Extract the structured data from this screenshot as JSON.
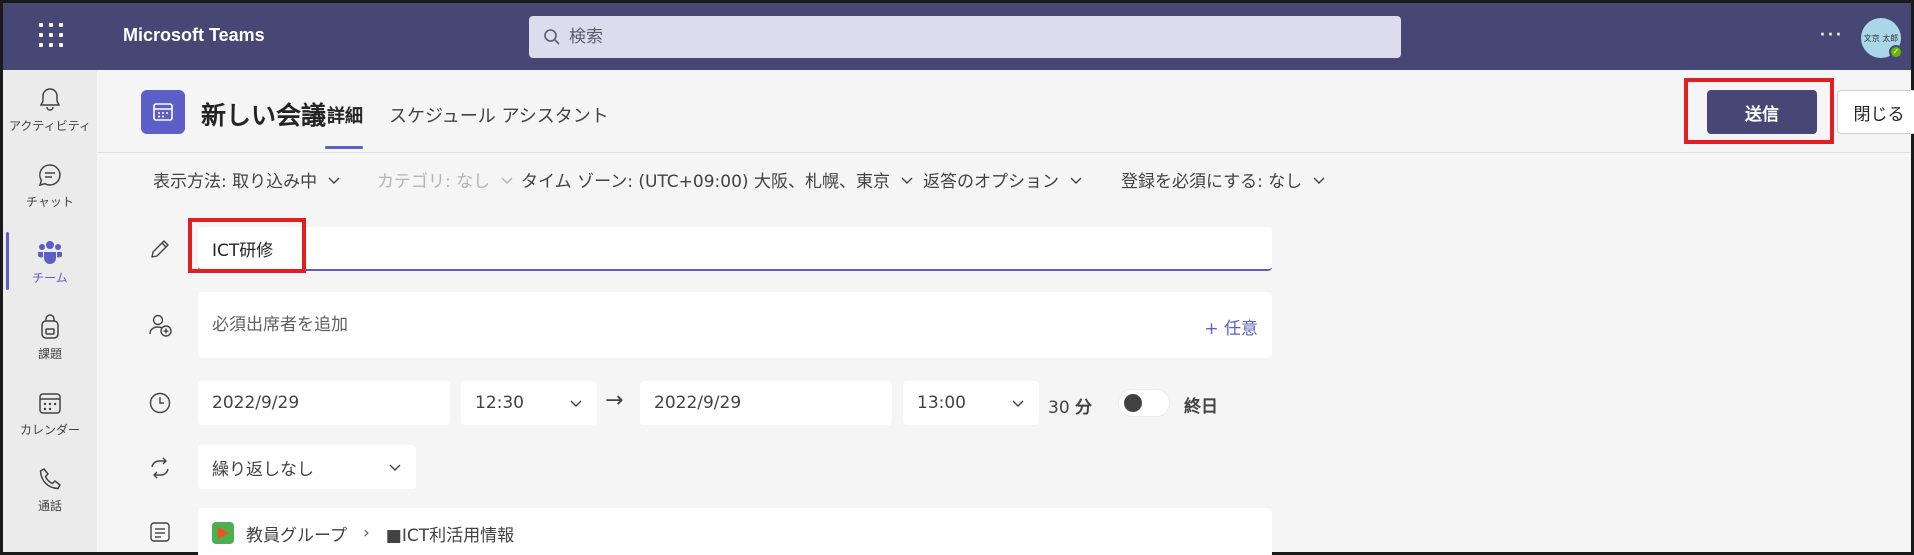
{
  "topbar": {
    "app_title": "Microsoft Teams",
    "search_placeholder": "検索",
    "more_label": "···",
    "avatar_initials": "文京 太郎"
  },
  "rail": {
    "items": [
      {
        "label": "アクティビティ",
        "icon": "bell-icon"
      },
      {
        "label": "チャット",
        "icon": "chat-icon"
      },
      {
        "label": "チーム",
        "icon": "teams-icon",
        "active": true
      },
      {
        "label": "課題",
        "icon": "backpack-icon"
      },
      {
        "label": "カレンダー",
        "icon": "calendar-icon"
      },
      {
        "label": "通話",
        "icon": "phone-icon"
      }
    ]
  },
  "header": {
    "title": "新しい会議",
    "tabs": [
      {
        "label": "詳細",
        "active": true
      },
      {
        "label": "スケジュール アシスタント",
        "active": false
      }
    ],
    "send_label": "送信",
    "close_label": "閉じる"
  },
  "options": {
    "display": "表示方法: 取り込み中",
    "category": "カテゴリ: なし",
    "timezone": "タイム ゾーン: (UTC+09:00) 大阪、札幌、東京",
    "response": "返答のオプション",
    "registration": "登録を必須にする: なし"
  },
  "form": {
    "title_value": "ICT研修",
    "attendees_placeholder": "必須出席者を追加",
    "optional_label": "+ 任意",
    "start_date": "2022/9/29",
    "start_time": "12:30",
    "end_date": "2022/9/29",
    "end_time": "13:00",
    "duration_num": "30",
    "duration_unit": "分",
    "allday_label": "終日",
    "repeat": "繰り返しなし",
    "channel_team": "教員グループ",
    "channel_name": "■ICT利活用情報"
  },
  "colors": {
    "topbar": "#464775",
    "accent": "#5b5fc7",
    "highlight": "#e02020"
  }
}
